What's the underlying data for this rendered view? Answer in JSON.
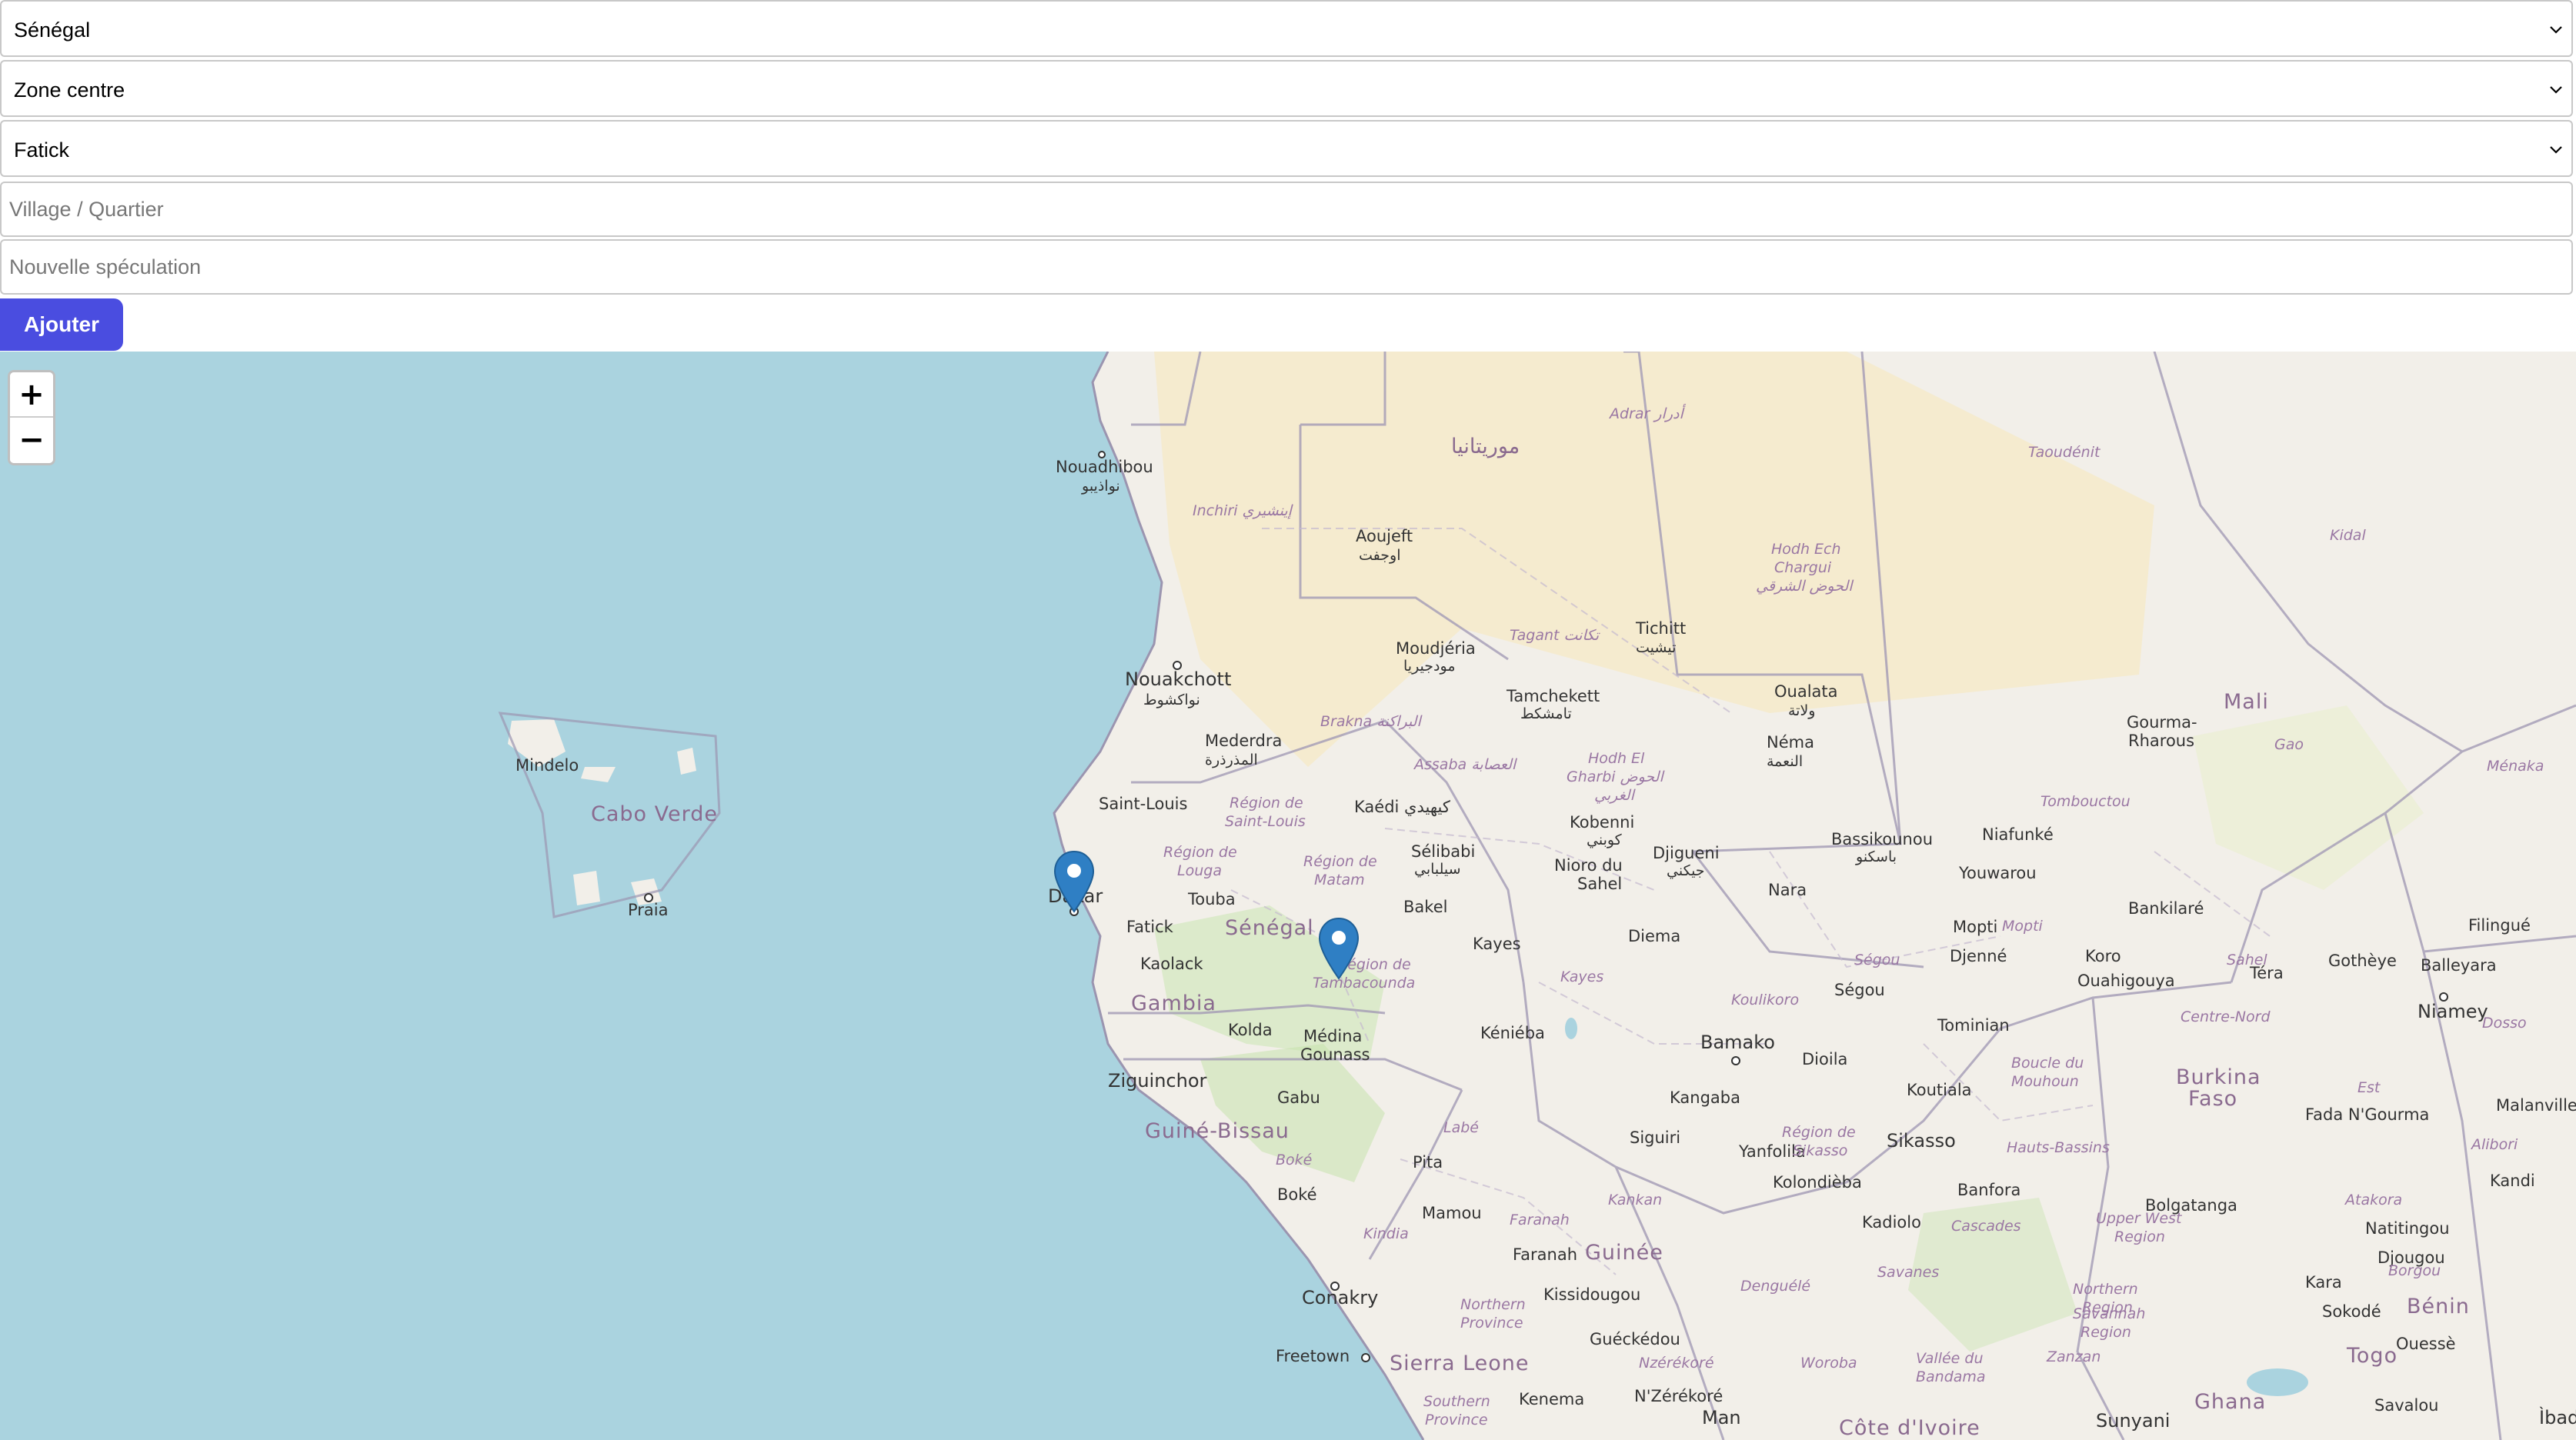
{
  "form": {
    "country_select": "Sénégal",
    "zone_select": "Zone centre",
    "region_select": "Fatick",
    "village_placeholder": "Village / Quartier",
    "speculation_placeholder": "Nouvelle spéculation",
    "add_button": "Ajouter"
  },
  "map": {
    "zoom_in": "+",
    "zoom_out": "−",
    "labels": {
      "nouadhibou": "Nouadhibou",
      "nouadhibou_ar": "نواذيبو",
      "inchiri": "Inchiri إينشيري",
      "aoujeft": "Aoujeft",
      "aoujeft_ar": "اوجفت",
      "mauritania_ar": "موريتانيا",
      "adrar": "Adrar أدرار",
      "taoudenit": "Taoudénit",
      "hodh_ech": "Hodh Ech",
      "chargui": "Chargui",
      "hodh_ar": "الحوض الشرقي",
      "kidal": "Kidal",
      "tagant": "Tagant تكانت",
      "tichitt": "Tichitt",
      "tichitt_ar": "تيشيت",
      "moudjeria": "Moudjéria",
      "moudjeria_ar": "مودجيريا",
      "nouakchott": "Nouakchott",
      "nouakchott_ar": "نواكشوط",
      "tamchekett": "Tamchekett",
      "tamchekett_ar": "تامشكط",
      "brakna": "Brakna البراكنة",
      "oualata": "Oualata",
      "oualata_ar": "ولاتة",
      "mali": "Mali",
      "gourma": "Gourma-",
      "rharous": "Rharous",
      "gao": "Gao",
      "menaka": "Ménaka",
      "mederdra": "Mederdra",
      "mederdra_ar": "المذرذرة",
      "assaba": "Assaba العصابة",
      "hodh_el": "Hodh El",
      "gharbi": "Gharbi الحوض",
      "gharbi_ar": "الغربي",
      "nema": "Néma",
      "nema_ar": "النعمة",
      "tombouctou": "Tombouctou",
      "mindelo": "Mindelo",
      "cabo_verde": "Cabo Verde",
      "praia": "Praia",
      "saint_louis": "Saint-Louis",
      "region_saint_louis_1": "Région de",
      "region_saint_louis_2": "Saint-Louis",
      "kaedi": "Kaédi كيهيدي",
      "kobenni": "Kobenni",
      "kobenni_ar": "كوبني",
      "djiguenni": "Djigueni",
      "djiguenni_ar": "جيكني",
      "bassikounou": "Bassikounou",
      "bassikounou_ar": "باسكنو",
      "niafunke": "Niafunké",
      "region_louga_1": "Région de",
      "region_louga_2": "Louga",
      "region_matam_1": "Région de",
      "region_matam_2": "Matam",
      "selibabi": "Sélibabi",
      "selibabi_ar": "سيلبابي",
      "nioro_1": "Nioro du",
      "nioro_2": "Sahel",
      "nara": "Nara",
      "youwarou": "Youwarou",
      "dakar": "Dakar",
      "touba": "Touba",
      "bakel": "Bakel",
      "bankilare": "Bankilaré",
      "filingue": "Filingué",
      "fatick": "Fatick",
      "senegal": "Sénégal",
      "kayes": "Kayes",
      "diema": "Diema",
      "mopti": "Mopti",
      "mopti_region": "Mopti",
      "djenne": "Djenné",
      "koro": "Koro",
      "ouahigouya": "Ouahigouya",
      "gotheye": "Gothèye",
      "balleyara": "Balleyara",
      "kaolack": "Kaolack",
      "region_tamba_1": "Région de",
      "region_tamba_2": "Tambacounda",
      "kayes_region": "Kayes",
      "segou_region": "Ségou",
      "segou": "Ségou",
      "sahel": "Sahel",
      "tera": "Téra",
      "niamey": "Niamey",
      "gambia": "Gambia",
      "kolda": "Kolda",
      "medina_1": "Médina",
      "medina_2": "Gounass",
      "kenieba": "Kéniéba",
      "bamako": "Bamako",
      "koulikoro": "Koulikoro",
      "tominian": "Tominian",
      "centre_nord": "Centre-Nord",
      "dosso": "Dosso",
      "ziguinchor": "Ziguinchor",
      "dioila": "Dioila",
      "boucle_1": "Boucle du",
      "boucle_2": "Mouhoun",
      "burkina_1": "Burkina",
      "burkina_2": "Faso",
      "gabu": "Gabu",
      "kangaba": "Kangaba",
      "koutiala": "Koutiala",
      "est": "Est",
      "fada": "Fada N'Gourma",
      "malanville": "Malanville",
      "guinee_bissau": "Guiné-Bissau",
      "labe": "Labé",
      "siguiri": "Siguiri",
      "yanfolila": "Yanfolila",
      "region_sikasso_1": "Région de",
      "region_sikasso_2": "Sikasso",
      "sikasso": "Sikasso",
      "hauts_bassins": "Hauts-Bassins",
      "alibori": "Alibori",
      "boke_region": "Boké",
      "pita": "Pita",
      "kolondieba": "Kolondièba",
      "banfora": "Banfora",
      "kandi": "Kandi",
      "boke": "Boké",
      "kankan": "Kankan",
      "kadiolo": "Kadiolo",
      "cascades": "Cascades",
      "bolgatanga": "Bolgatanga",
      "atakora": "Atakora",
      "kindia": "Kindia",
      "mamou": "Mamou",
      "faranah_region": "Faranah",
      "upper_west_1": "Upper West",
      "upper_west_2": "Region",
      "natitingou": "Natitingou",
      "faranah": "Faranah",
      "guinee": "Guinée",
      "djougou": "Djougou",
      "denguele": "Denguélé",
      "savanes": "Savanes",
      "borgou": "Borgou",
      "conakry": "Conakry",
      "kissidougou": "Kissidougou",
      "northern_region_1": "Northern",
      "northern_region_2": "Region",
      "kara": "Kara",
      "benin": "Bénin",
      "northern_prov_1": "Northern",
      "northern_prov_2": "Province",
      "sokode": "Sokodé",
      "gueckedou": "Guéckédou",
      "savannah_1": "Savannah",
      "savannah_2": "Region",
      "ouesse": "Ouessè",
      "freetown": "Freetown",
      "sierra_leone": "Sierra Leone",
      "nzerekore_region": "Nzérékoré",
      "woroba": "Woroba",
      "vallee_1": "Vallée du",
      "vallee_2": "Bandama",
      "zanzan": "Zanzan",
      "togo": "Togo",
      "southern_1": "Southern",
      "southern_2": "Province",
      "kenema": "Kenema",
      "nzerekore": "N'Zérékoré",
      "ghana": "Ghana",
      "savalou": "Savalou",
      "man": "Man",
      "cote_divoire": "Côte d'Ivoire",
      "sunyani": "Sunyani",
      "ibadan": "Ìbad"
    }
  }
}
